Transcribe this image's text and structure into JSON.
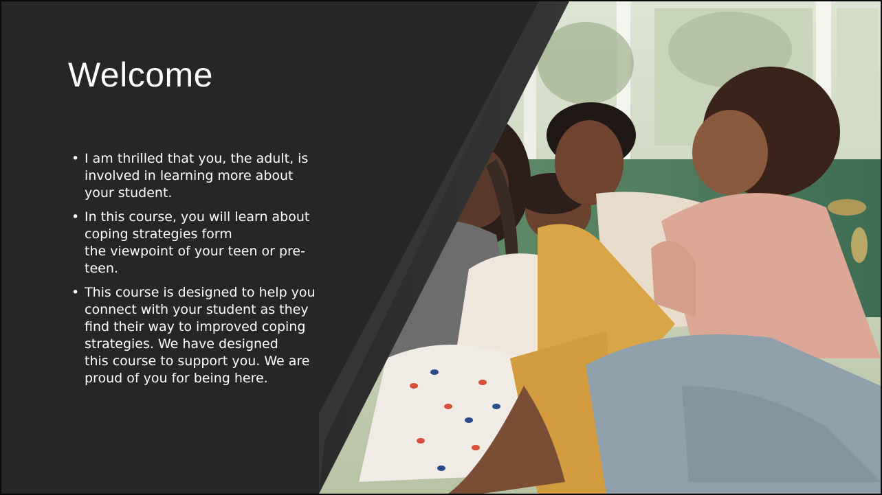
{
  "slide": {
    "title": "Welcome",
    "bullets": [
      {
        "line1": "I am thrilled that you, the adult, is",
        "line2": "involved in learning more about",
        "line3": "your student."
      },
      {
        "line1": "In this course, you will learn about",
        "line2": "coping strategies form",
        "line3": "the viewpoint of your teen or pre-",
        "line4": "teen."
      },
      {
        "line1": "This course is designed to help you",
        "line2": "connect with your student as they",
        "line3": "find their way to improved coping",
        "line4": "strategies. We have designed",
        "line5": "this course to support you. We are",
        "line6": "proud of you for being here."
      }
    ],
    "bullet_symbol": "•"
  },
  "colors": {
    "panel_background": "#262626",
    "text": "#ffffff"
  }
}
